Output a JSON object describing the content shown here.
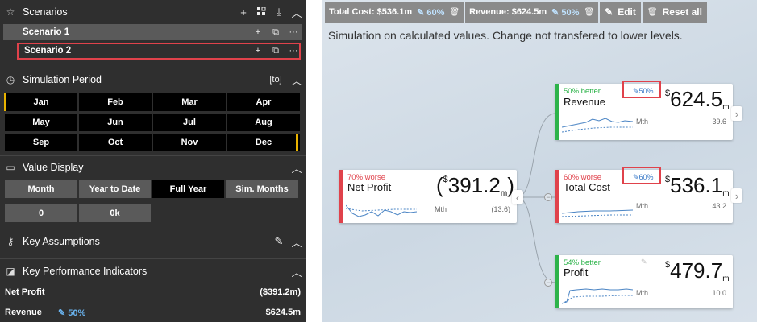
{
  "left": {
    "scenarios": {
      "title": "Scenarios",
      "items": [
        "Scenario 1",
        "Scenario 2"
      ]
    },
    "simulation_period": {
      "title": "Simulation Period",
      "to_label": "[to]",
      "months": [
        "Jan",
        "Feb",
        "Mar",
        "Apr",
        "May",
        "Jun",
        "Jul",
        "Aug",
        "Sep",
        "Oct",
        "Nov",
        "Dec"
      ]
    },
    "value_display": {
      "title": "Value Display",
      "options": [
        "Month",
        "Year to Date",
        "Full Year",
        "Sim. Months"
      ],
      "selected": "Full Year",
      "fields": [
        "0",
        "0k"
      ]
    },
    "key_assumptions": {
      "title": "Key Assumptions"
    },
    "kpi": {
      "title": "Key Performance Indicators",
      "rows": [
        {
          "label": "Net Profit",
          "pct": "",
          "value": "($391.2m)"
        },
        {
          "label": "Revenue",
          "pct": "50%",
          "value": "$624.5m"
        }
      ]
    }
  },
  "toolbar": {
    "total_cost_label": "Total Cost: $536.1m",
    "total_cost_pct": "60%",
    "revenue_label": "Revenue: $624.5m",
    "revenue_pct": "50%",
    "edit_label": "Edit",
    "reset_label": "Reset all"
  },
  "note": "Simulation on calculated values. Change not transfered to lower levels.",
  "cards": {
    "net_profit": {
      "status": "70% worse",
      "name": "Net Profit",
      "prefix": "(",
      "currency": "$",
      "value": "391.2",
      "unit": "m",
      "suffix": ")",
      "period": "Mth",
      "tail": "(13.6)"
    },
    "revenue": {
      "status": "50% better",
      "name": "Revenue",
      "pct": "50%",
      "currency": "$",
      "value": "624.5",
      "unit": "m",
      "period": "Mth",
      "tail": "39.6"
    },
    "total_cost": {
      "status": "60% worse",
      "name": "Total Cost",
      "pct": "60%",
      "currency": "$",
      "value": "536.1",
      "unit": "m",
      "period": "Mth",
      "tail": "43.2"
    },
    "profit": {
      "status": "54% better",
      "name": "Profit",
      "currency": "$",
      "value": "479.7",
      "unit": "m",
      "period": "Mth",
      "tail": "10.0"
    }
  },
  "colors": {
    "worse": "#e0424b",
    "better": "#2db34a",
    "highlight": "#e0424b",
    "accent": "#e8b200"
  }
}
